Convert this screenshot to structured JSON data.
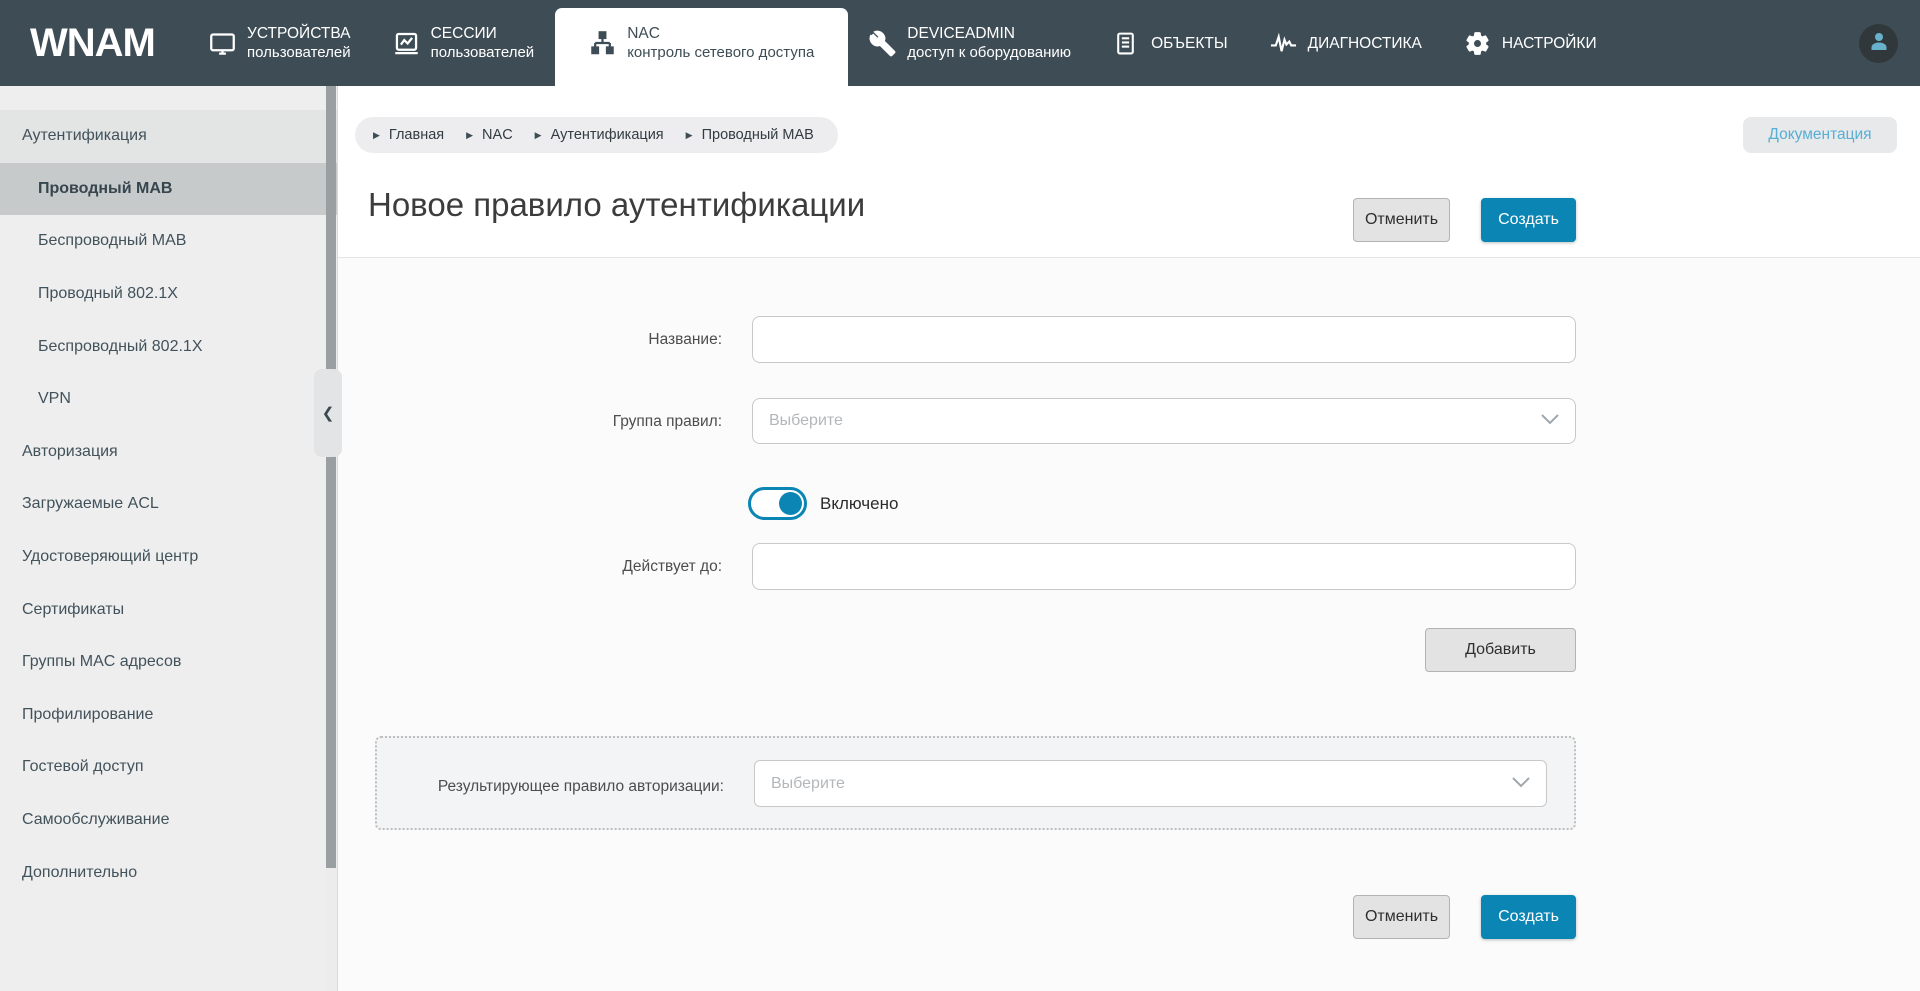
{
  "navbar": {
    "logo": "WNAM",
    "items": [
      {
        "icon": "monitor-icon",
        "line1": "УСТРОЙСТВА",
        "line2": "пользователей",
        "active": false
      },
      {
        "icon": "sessions-icon",
        "line1": "СЕССИИ",
        "line2": "пользователей",
        "active": false
      },
      {
        "icon": "sitemap-icon",
        "line1": "NAC",
        "line2": "контроль сетевого доступа",
        "active": true
      },
      {
        "icon": "tools-icon",
        "line1": "DEVICEADMIN",
        "line2": "доступ к оборудованию",
        "active": false
      },
      {
        "icon": "document-icon",
        "line1": "ОБЪЕКТЫ",
        "line2": "",
        "active": false
      },
      {
        "icon": "pulse-icon",
        "line1": "ДИАГНОСТИКА",
        "line2": "",
        "active": false
      },
      {
        "icon": "gear-icon",
        "line1": "НАСТРОЙКИ",
        "line2": "",
        "active": false
      }
    ]
  },
  "sidebar": {
    "items": [
      {
        "label": "Аутентификация",
        "level": 0,
        "section": true,
        "active": false
      },
      {
        "label": "Проводный MAB",
        "level": 1,
        "section": false,
        "active": true
      },
      {
        "label": "Беспроводный MAB",
        "level": 1,
        "section": false,
        "active": false
      },
      {
        "label": "Проводный 802.1X",
        "level": 1,
        "section": false,
        "active": false
      },
      {
        "label": "Беспроводный 802.1X",
        "level": 1,
        "section": false,
        "active": false
      },
      {
        "label": "VPN",
        "level": 1,
        "section": false,
        "active": false
      },
      {
        "label": "Авторизация",
        "level": 0,
        "section": false,
        "active": false
      },
      {
        "label": "Загружаемые ACL",
        "level": 0,
        "section": false,
        "active": false
      },
      {
        "label": "Удостоверяющий центр",
        "level": 0,
        "section": false,
        "active": false
      },
      {
        "label": "Сертификаты",
        "level": 0,
        "section": false,
        "active": false
      },
      {
        "label": "Группы MAC адресов",
        "level": 0,
        "section": false,
        "active": false
      },
      {
        "label": "Профилирование",
        "level": 0,
        "section": false,
        "active": false
      },
      {
        "label": "Гостевой доступ",
        "level": 0,
        "section": false,
        "active": false
      },
      {
        "label": "Самообслуживание",
        "level": 0,
        "section": false,
        "active": false
      },
      {
        "label": "Дополнительно",
        "level": 0,
        "section": false,
        "active": false
      }
    ],
    "collapse_glyph": "❮"
  },
  "breadcrumb": {
    "items": [
      "Главная",
      "NAC",
      "Аутентификация",
      "Проводный MAB"
    ],
    "arrow_glyph": "▶"
  },
  "header": {
    "doc_label": "Документация",
    "title": "Новое правило аутентификации",
    "cancel_label": "Отменить",
    "create_label": "Создать"
  },
  "form": {
    "name_label": "Название:",
    "name_value": "",
    "group_label": "Группа правил:",
    "group_placeholder": "Выберите",
    "enabled_label": "Включено",
    "enabled_state": true,
    "valid_until_label": "Действует до:",
    "valid_until_value": "",
    "add_label": "Добавить",
    "result_rule_label": "Результирующее правило авторизации:",
    "result_rule_placeholder": "Выберите",
    "cancel_label": "Отменить",
    "create_label": "Создать"
  },
  "colors": {
    "navbar_bg": "#3e4d55",
    "accent_blue": "#0a85b4",
    "sidebar_bg": "#eeeeee",
    "sidebar_active_bg": "#c7cacb",
    "doc_link_text": "#58aed3"
  }
}
